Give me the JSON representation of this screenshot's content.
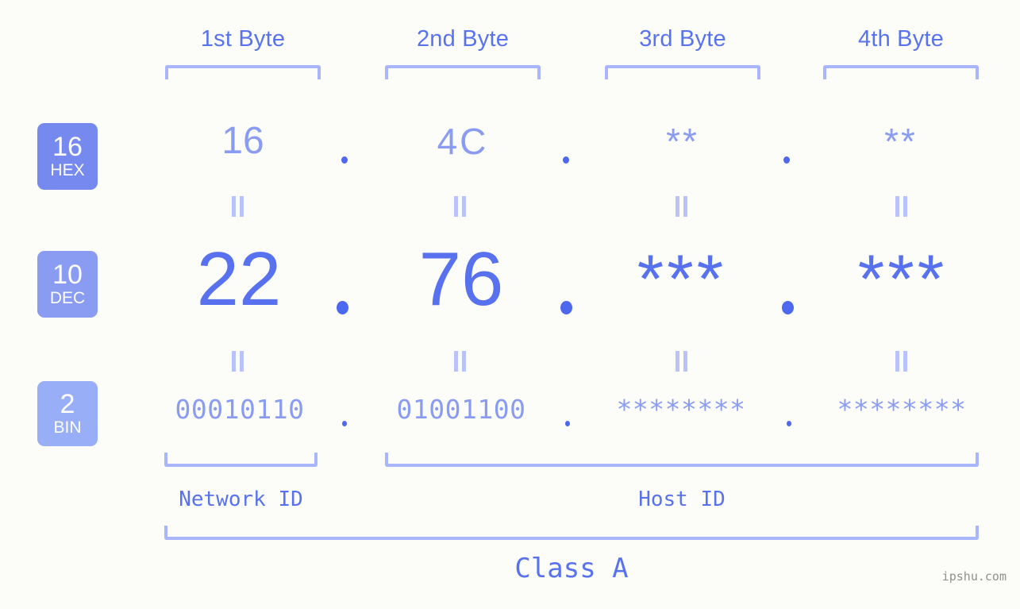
{
  "colors": {
    "background": "#fcfdf8",
    "accent_dark": "#4d68ee",
    "accent_mid": "#5872ef",
    "accent_light": "#8a9bf2",
    "bracket": "#aab6fb",
    "badge_hex": "#7689ee",
    "badge_dec": "#8a9bf2",
    "badge_bin": "#98aef7",
    "watermark": "#8f8f8f"
  },
  "byte_headers": [
    {
      "label": "1st Byte"
    },
    {
      "label": "2nd Byte"
    },
    {
      "label": "3rd Byte"
    },
    {
      "label": "4th Byte"
    }
  ],
  "bases": [
    {
      "number": "16",
      "name": "HEX"
    },
    {
      "number": "10",
      "name": "DEC"
    },
    {
      "number": "2",
      "name": "BIN"
    }
  ],
  "rows": {
    "hex": {
      "values": [
        "16",
        "4C",
        "**",
        "**"
      ]
    },
    "dec": {
      "values": [
        "22",
        "76",
        "***",
        "***"
      ]
    },
    "bin": {
      "values": [
        "00010110",
        "01001100",
        "********",
        "********"
      ]
    }
  },
  "separators": {
    "symbol": "."
  },
  "equals": {
    "symbol": "="
  },
  "segments": [
    {
      "label": "Network ID"
    },
    {
      "label": "Host ID"
    }
  ],
  "class": {
    "label": "Class A"
  },
  "watermark": {
    "text": "ipshu.com"
  }
}
